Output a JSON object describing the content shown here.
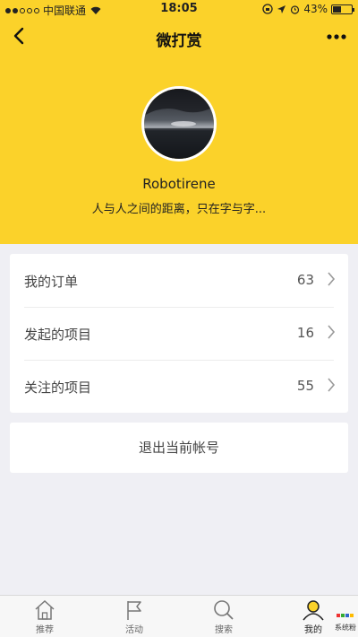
{
  "status": {
    "carrier": "中国联通",
    "time": "18:05",
    "battery": "43%",
    "battery_level": 0.43
  },
  "nav": {
    "title": "微打赏"
  },
  "profile": {
    "username": "Robotirene",
    "bio": "人与人之间的距离，只在字与字..."
  },
  "menu": [
    {
      "label": "我的订单",
      "count": "63"
    },
    {
      "label": "发起的项目",
      "count": "16"
    },
    {
      "label": "关注的项目",
      "count": "55"
    }
  ],
  "logout_label": "退出当前帐号",
  "tabs": [
    {
      "label": "推荐",
      "icon": "home-icon"
    },
    {
      "label": "活动",
      "icon": "flag-icon"
    },
    {
      "label": "搜索",
      "icon": "search-icon"
    },
    {
      "label": "我的",
      "icon": "user-icon",
      "active": true
    }
  ],
  "watermark": "系统粉",
  "colors": {
    "accent": "#fbd22a",
    "background": "#efeff4"
  }
}
